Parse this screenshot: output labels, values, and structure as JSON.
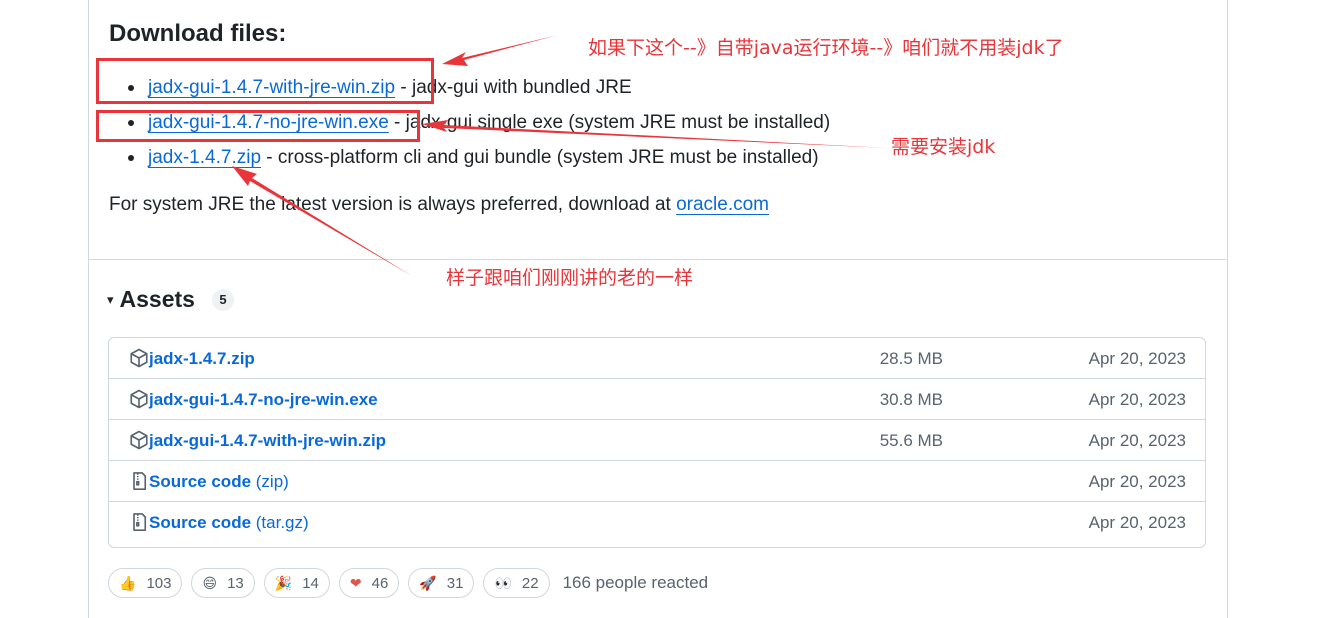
{
  "download": {
    "heading": "Download files:",
    "items": [
      {
        "link": "jadx-gui-1.4.7-with-jre-win.zip",
        "desc": " - jadx-gui with bundled JRE"
      },
      {
        "link": "jadx-gui-1.4.7-no-jre-win.exe",
        "desc": " - jadx-gui single exe (system JRE must be installed)"
      },
      {
        "link": "jadx-1.4.7.zip",
        "desc": " - cross-platform cli and gui bundle (system JRE must be installed)"
      }
    ],
    "note_prefix": "For system JRE the latest version is always preferred, download at ",
    "note_link": "oracle.com"
  },
  "assets": {
    "caret": "▾",
    "title": "Assets",
    "count": "5",
    "rows": [
      {
        "icon": "package-icon",
        "name": "jadx-1.4.7.zip",
        "sub": "",
        "size": "28.5 MB",
        "date": "Apr 20, 2023"
      },
      {
        "icon": "package-icon",
        "name": "jadx-gui-1.4.7-no-jre-win.exe",
        "sub": "",
        "size": "30.8 MB",
        "date": "Apr 20, 2023"
      },
      {
        "icon": "package-icon",
        "name": "jadx-gui-1.4.7-with-jre-win.zip",
        "sub": "",
        "size": "55.6 MB",
        "date": "Apr 20, 2023"
      },
      {
        "icon": "file-zip-icon",
        "name": "Source code",
        "sub": " (zip)",
        "size": "",
        "date": "Apr 20, 2023"
      },
      {
        "icon": "file-zip-icon",
        "name": "Source code",
        "sub": " (tar.gz)",
        "size": "",
        "date": "Apr 20, 2023"
      }
    ]
  },
  "reactions": {
    "items": [
      {
        "emoji": "👍",
        "icon": "thumbs-up-icon",
        "count": "103"
      },
      {
        "emoji": "😄",
        "icon": "laugh-icon",
        "count": "13"
      },
      {
        "emoji": "🎉",
        "icon": "tada-icon",
        "count": "14"
      },
      {
        "emoji": "❤",
        "icon": "heart-icon",
        "count": "46"
      },
      {
        "emoji": "🚀",
        "icon": "rocket-icon",
        "count": "31"
      },
      {
        "emoji": "👀",
        "icon": "eyes-icon",
        "count": "22"
      }
    ],
    "summary": "166 people reacted"
  },
  "annotations": {
    "top": "如果下这个--》自带java运行环境--》咱们就不用装jdk了",
    "middle": "需要安装jdk",
    "bottom": "样子跟咱们刚刚讲的老的一样"
  },
  "colors": {
    "link": "#0969da",
    "annotation": "#e8353a",
    "border": "#d0d7de",
    "muted": "#59636e"
  }
}
